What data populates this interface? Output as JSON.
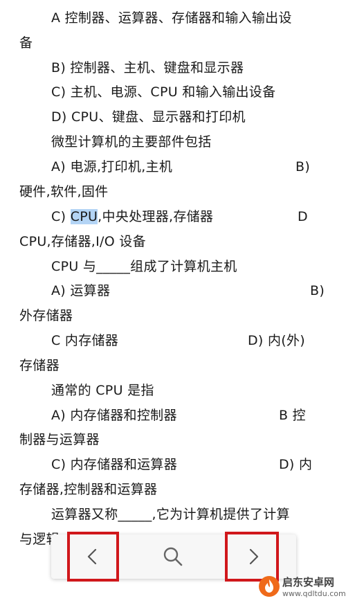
{
  "document": {
    "lines": {
      "l1": "A 控制器、运算器、存储器和输入输出设",
      "l2": "备",
      "l3": "B)  控制器、主机、键盘和显示器",
      "l4": "C)  主机、电源、CPU 和输入输出设备",
      "l5": "D) CPU、键盘、显示器和打印机",
      "l6": "微型计算机的主要部件包括",
      "l7a": "A)  电源,打印机,主机",
      "l7b": "B)",
      "l8": "硬件,软件,固件",
      "l9a_pre": "C) ",
      "l9a_hl": "CPU",
      "l9a_post": ",中央处理器,存储器",
      "l9b": "D",
      "l10": "CPU,存储器,I/O 设备",
      "l11": "CPU 与_____组成了计算机主机",
      "l12a": "A)  运算器",
      "l12b": "B)",
      "l13": "外存储器",
      "l14a": "C  内存储器",
      "l14b": "D)  内(外)",
      "l15": "存储器",
      "l16": "通常的 CPU 是指",
      "l17a": "A)  内存储器和控制器",
      "l17b": "B  控",
      "l18": "制器与运算器",
      "l19a": "C)  内存储器和运算器",
      "l19b": "D)  内",
      "l20": "存储器,控制器和运算器",
      "l21": "运算器又称_____,它为计算机提供了计算",
      "l22": "与逻辑"
    }
  },
  "toolbar": {
    "prev_icon": "chevron-left-icon",
    "search_icon": "search-icon",
    "next_icon": "chevron-right-icon"
  },
  "watermark": {
    "title": "启东安卓网",
    "url": "www.qdltdu.com",
    "logo_icon": "flame-logo-icon"
  },
  "colors": {
    "highlight": "#b3d4f5",
    "annotation_red": "#d0171b",
    "toolbar_bg": "#f7f7f7",
    "logo_orange": "#ef6a1a"
  }
}
